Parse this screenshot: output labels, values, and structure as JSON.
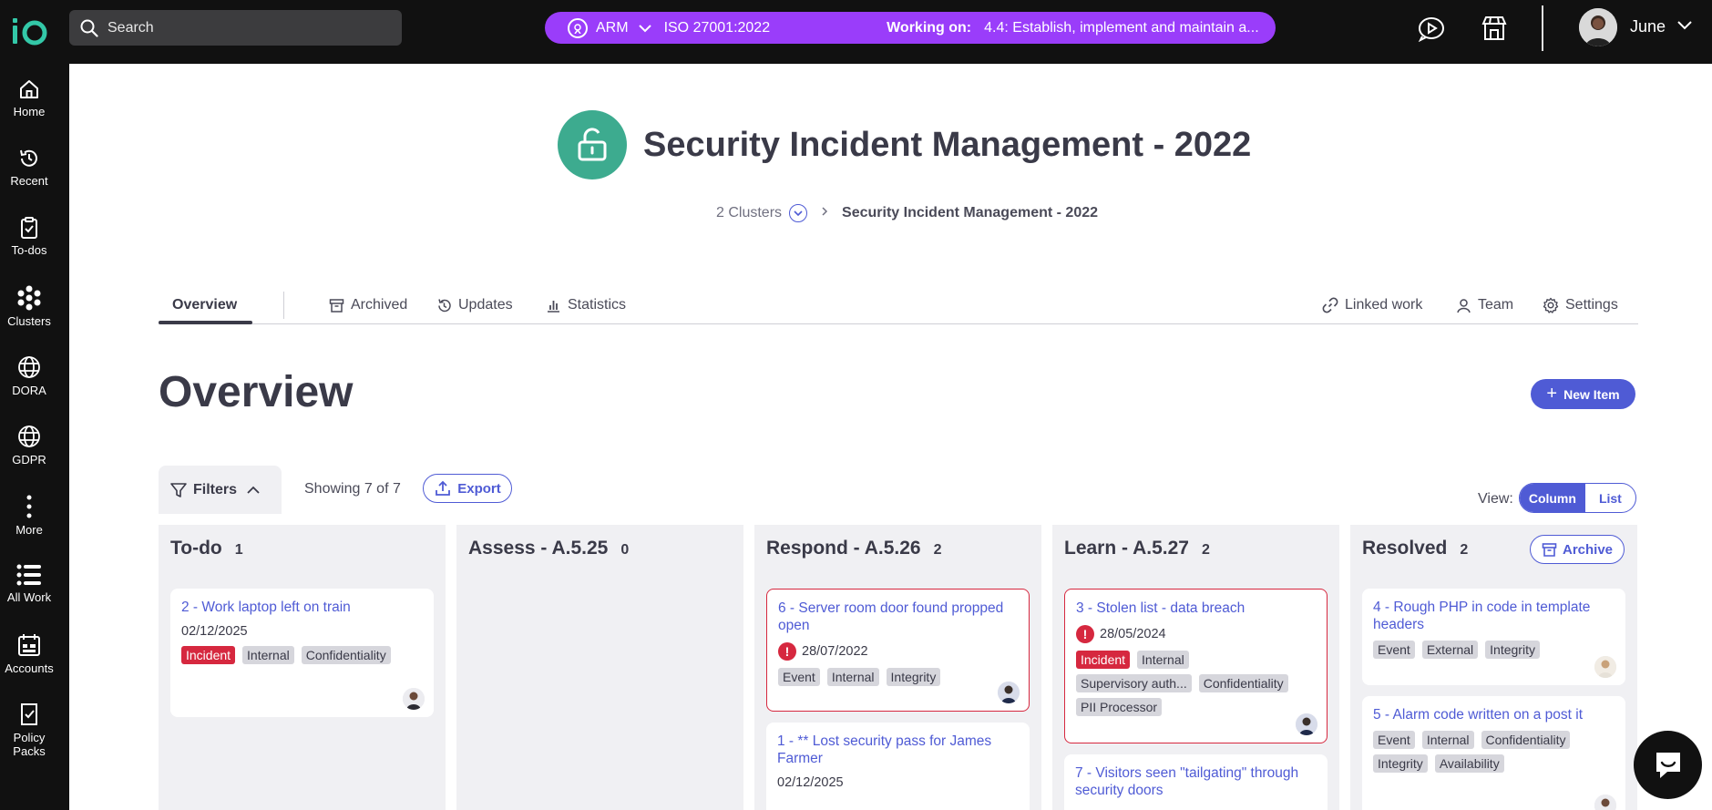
{
  "topbar": {
    "search_label": "Search",
    "org": "ARM",
    "standard": "ISO 27001:2022",
    "working_label": "Working on:",
    "working_value": "4.4: Establish, implement and maintain a...",
    "user_name": "June",
    "accent_color": "#9a3dfa"
  },
  "sidebar": {
    "items": [
      {
        "label": "Home",
        "icon": "home-icon"
      },
      {
        "label": "Recent",
        "icon": "history-icon"
      },
      {
        "label": "To-dos",
        "icon": "clipboard-check-icon"
      },
      {
        "label": "Clusters",
        "icon": "clusters-icon"
      },
      {
        "label": "DORA",
        "icon": "globe-icon"
      },
      {
        "label": "GDPR",
        "icon": "globe-icon"
      },
      {
        "label": "More",
        "icon": "more-vertical-icon"
      },
      {
        "label": "All Work",
        "icon": "list-icon"
      },
      {
        "label": "Accounts",
        "icon": "accounts-icon"
      },
      {
        "label": "Policy Packs",
        "icon": "policy-icon"
      }
    ]
  },
  "project": {
    "title": "Security Incident Management - 2022",
    "breadcrumb_clusters": "2 Clusters",
    "breadcrumb_current": "Security Incident Management - 2022",
    "icon_color": "#3dab8f"
  },
  "tabs": {
    "overview": "Overview",
    "archived": "Archived",
    "updates": "Updates",
    "statistics": "Statistics",
    "linked_work": "Linked work",
    "team": "Team",
    "settings": "Settings"
  },
  "overview": {
    "heading": "Overview",
    "new_item": "New Item",
    "filters": "Filters",
    "showing": "Showing 7 of 7",
    "export": "Export",
    "view_label": "View:",
    "view_column": "Column",
    "view_list": "List",
    "archive": "Archive"
  },
  "board": {
    "columns": [
      {
        "name": "To-do",
        "count": "1"
      },
      {
        "name": "Assess - A.5.25",
        "count": "0"
      },
      {
        "name": "Respond - A.5.26",
        "count": "2"
      },
      {
        "name": "Learn - A.5.27",
        "count": "2"
      },
      {
        "name": "Resolved",
        "count": "2"
      }
    ],
    "cards": {
      "todo_1": {
        "title": "2 - Work laptop left on train",
        "date": "02/12/2025",
        "tags": [
          "Incident",
          "Internal",
          "Confidentiality"
        ]
      },
      "respond_1": {
        "title": "6 - Server room door found propped open",
        "date": "28/07/2022",
        "tags": [
          "Event",
          "Internal",
          "Integrity"
        ]
      },
      "respond_2": {
        "title": "1 - ** Lost security pass for James Farmer",
        "date": "02/12/2025"
      },
      "learn_1": {
        "title": "3 - Stolen list - data breach",
        "date": "28/05/2024",
        "tags": [
          "Incident",
          "Internal",
          "Supervisory auth...",
          "Confidentiality",
          "PII Processor"
        ]
      },
      "learn_2": {
        "title": "7 - Visitors seen \"tailgating\" through security doors"
      },
      "resolved_1": {
        "title": "4 - Rough PHP in code in template headers",
        "tags": [
          "Event",
          "External",
          "Integrity"
        ]
      },
      "resolved_2": {
        "title": "5 - Alarm code written on a post it",
        "tags": [
          "Event",
          "Internal",
          "Confidentiality",
          "Integrity",
          "Availability"
        ]
      }
    }
  },
  "colors": {
    "primary": "#4f5bd5",
    "danger": "#d6283f",
    "topbar": "#111111"
  }
}
